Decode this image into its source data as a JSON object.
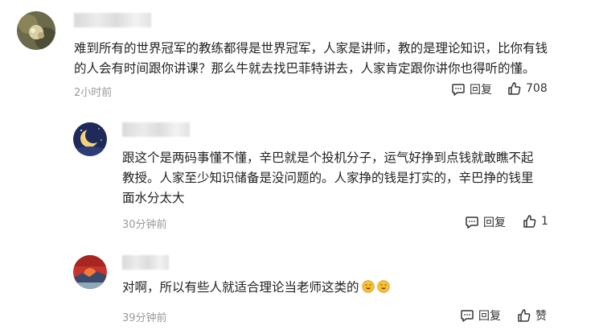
{
  "comments": [
    {
      "text": "难到所有的世界冠军的教练都得是世界冠军，人家是讲师，教的是理论知识，比你有钱的人会有时间跟你讲课？那么牛就去找巴菲特讲去，人家肯定跟你讲你也得听的懂。",
      "time": "2小时前",
      "reply_label": "回复",
      "like_count": "708"
    },
    {
      "text": "跟这个是两码事懂不懂，辛巴就是个投机分子，运气好挣到点钱就敢瞧不起教授。人家至少知识储备是没问题的。人家挣的钱是打实的，辛巴挣的钱里面水分太大",
      "time": "30分钟前",
      "reply_label": "回复",
      "like_count": "1"
    },
    {
      "text": "对啊，所以有些人就适合理论当老师这类的",
      "time": "39分钟前",
      "reply_label": "回复",
      "like_count": "赞"
    }
  ]
}
